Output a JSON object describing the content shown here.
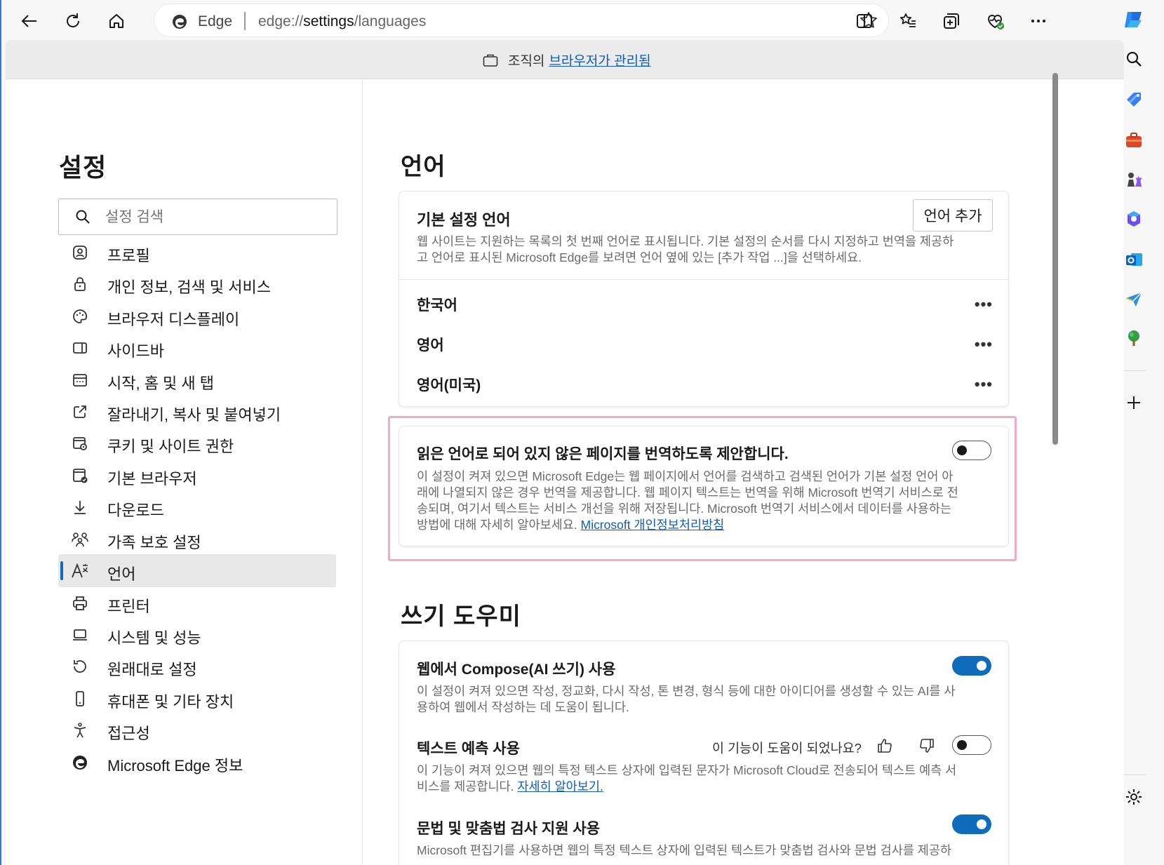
{
  "browser": {
    "address_label": "Edge",
    "url_prefix": "edge://",
    "url_highlight": "settings",
    "url_suffix": "/languages"
  },
  "managed": {
    "prefix": "조직의",
    "link": "브라우저가 관리됨"
  },
  "sidebar": {
    "title": "설정",
    "search_placeholder": "설정 검색",
    "items": [
      {
        "label": "프로필",
        "icon": "profile-icon"
      },
      {
        "label": "개인 정보, 검색 및 서비스",
        "icon": "lock-icon"
      },
      {
        "label": "브라우저 디스플레이",
        "icon": "palette-icon"
      },
      {
        "label": "사이드바",
        "icon": "sidebar-icon"
      },
      {
        "label": "시작, 홈 및 새 탭",
        "icon": "home-tabs-icon"
      },
      {
        "label": "잘라내기, 복사 및 붙여넣기",
        "icon": "share-icon"
      },
      {
        "label": "쿠키 및 사이트 권한",
        "icon": "site-permissions-icon"
      },
      {
        "label": "기본 브라우저",
        "icon": "default-browser-icon"
      },
      {
        "label": "다운로드",
        "icon": "download-icon"
      },
      {
        "label": "가족 보호 설정",
        "icon": "family-icon"
      },
      {
        "label": "언어",
        "icon": "language-icon",
        "active": true
      },
      {
        "label": "프린터",
        "icon": "printer-icon"
      },
      {
        "label": "시스템 및 성능",
        "icon": "laptop-icon"
      },
      {
        "label": "원래대로 설정",
        "icon": "reset-icon"
      },
      {
        "label": "휴대폰 및 기타 장치",
        "icon": "phone-icon"
      },
      {
        "label": "접근성",
        "icon": "accessibility-icon"
      },
      {
        "label": "Microsoft Edge 정보",
        "icon": "edge-icon"
      }
    ]
  },
  "languages": {
    "heading": "언어",
    "preferred": {
      "title": "기본 설정 언어",
      "add_button": "언어 추가",
      "desc_line1": "웹 사이트는 지원하는 목록의 첫 번째 언어로 표시됩니다. 기본 설정의 순서를 다시 지정하고 번역을 제공하",
      "desc_line2": "고 언어로 표시된 Microsoft Edge를 보려면 언어 옆에 있는 [추가 작업 ...]을 선택하세요.",
      "list": [
        {
          "name": "한국어",
          "more": "•••"
        },
        {
          "name": "영어",
          "more": "•••"
        },
        {
          "name": "영어(미국)",
          "more": "•••"
        }
      ]
    },
    "translate": {
      "title": "읽은 언어로 되어 있지 않은 페이지를 번역하도록 제안합니다.",
      "enabled": false,
      "desc_line1": "이 설정이 켜져 있으면 Microsoft Edge는 웹 페이지에서 언어를 검색하고 검색된 언어가 기본 설정 언어 아",
      "desc_line2": "래에 나열되지 않은 경우 번역을 제공합니다. 웹 페이지 텍스트는 번역을 위해 Microsoft 번역기 서비스로 전",
      "desc_line3": "송되며, 여기서 텍스트는 서비스 개선을 위해 저장됩니다. Microsoft 번역기 서비스에서 데이터를 사용하는",
      "desc_line4": "방법에 대해 자세히 알아보세요.",
      "link": "Microsoft 개인정보처리방침"
    }
  },
  "writing": {
    "heading": "쓰기 도우미",
    "compose": {
      "title": "웹에서 Compose(AI 쓰기) 사용",
      "enabled": true,
      "desc_line1": "이 설정이 켜져 있으면 작성, 정교화, 다시 작성, 톤 변경, 형식 등에 대한 아이디어를 생성할 수 있는 AI를 사",
      "desc_line2": "용하여 웹에서 작성하는 데 도움이 됩니다."
    },
    "prediction": {
      "title": "텍스트 예측 사용",
      "feedback_question": "이 기능이 도움이 되었나요?",
      "enabled": false,
      "desc_line1": "이 기능이 켜져 있으면 웹의 특정 텍스트 상자에 입력된 문자가 Microsoft Cloud로 전송되어 텍스트 예측 서",
      "desc_line2": "비스를 제공합니다.",
      "link": "자세히 알아보기."
    },
    "grammar": {
      "title": "문법 및 맞춤법 검사 지원 사용",
      "enabled": true,
      "desc_line1": "Microsoft 편집기를 사용하면 웹의 특정 텍스트 상자에 입력된 텍스트가 맞춤법 검사와 문법 검사를 제공하"
    }
  },
  "colors": {
    "accent": "#0f6cbd",
    "highlight": "#f4a9c7",
    "link": "#0f5db8"
  }
}
